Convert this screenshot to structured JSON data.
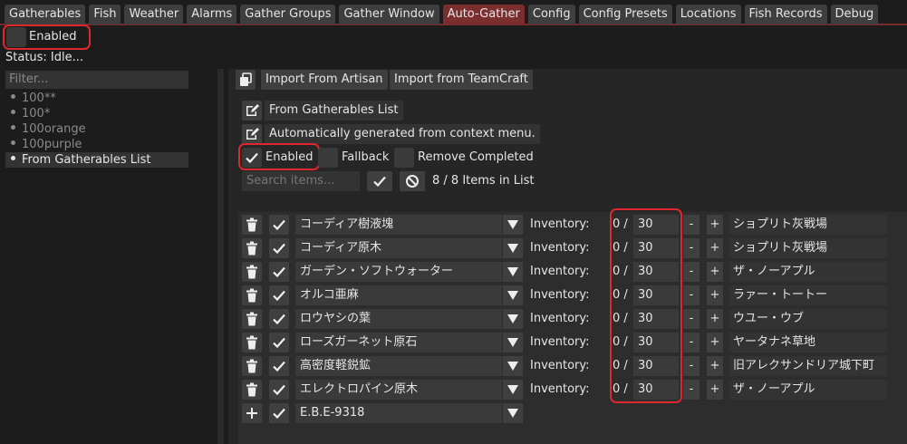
{
  "tabs": [
    "Gatherables",
    "Fish",
    "Weather",
    "Alarms",
    "Gather Groups",
    "Gather Window",
    "Auto-Gather",
    "Config",
    "Config Presets",
    "Locations",
    "Fish Records",
    "Debug"
  ],
  "active_tab": "Auto-Gather",
  "auto_gather": {
    "enabled_label": "Enabled",
    "status": "Status: Idle..."
  },
  "presets": {
    "filter_placeholder": "Filter...",
    "items": [
      "100**",
      "100*",
      "100orange",
      "100purple",
      "From Gatherables List"
    ],
    "selected": "From Gatherables List"
  },
  "toolbar": {
    "import_artisan": "Import From Artisan",
    "import_teamcraft": "Import from TeamCraft"
  },
  "list": {
    "name": "From Gatherables List",
    "description": "Automatically generated from context menu.",
    "enabled_label": "Enabled",
    "fallback_label": "Fallback",
    "remove_completed_label": "Remove Completed",
    "search_placeholder": "Search items...",
    "count_text": "8 / 8 Items in List"
  },
  "items": [
    {
      "name": "コーディア樹液塊",
      "inventory_label": "Inventory:",
      "have": "0 /",
      "target": "30",
      "location": "ショプリト灰戦場"
    },
    {
      "name": "コーディア原木",
      "inventory_label": "Inventory:",
      "have": "0 /",
      "target": "30",
      "location": "ショプリト灰戦場"
    },
    {
      "name": "ガーデン・ソフトウォーター",
      "inventory_label": "Inventory:",
      "have": "0 /",
      "target": "30",
      "location": "ザ・ノーアプル"
    },
    {
      "name": "オルコ亜麻",
      "inventory_label": "Inventory:",
      "have": "0 /",
      "target": "30",
      "location": "ラァー・トートー"
    },
    {
      "name": "ロウヤシの葉",
      "inventory_label": "Inventory:",
      "have": "0 /",
      "target": "30",
      "location": "ウユー・ウブ"
    },
    {
      "name": "ローズガーネット原石",
      "inventory_label": "Inventory:",
      "have": "0 /",
      "target": "30",
      "location": "ヤータナネ草地"
    },
    {
      "name": "高密度軽鋭鉱",
      "inventory_label": "Inventory:",
      "have": "0 /",
      "target": "30",
      "location": "旧アレクサンドリア城下町"
    },
    {
      "name": "エレクトロパイン原木",
      "inventory_label": "Inventory:",
      "have": "0 /",
      "target": "30",
      "location": "ザ・ノーアプル"
    }
  ],
  "new_item": {
    "name": "E.B.E-9318"
  },
  "colors": {
    "highlight": "#e0262e",
    "active_tab": "#7a2e2e"
  }
}
